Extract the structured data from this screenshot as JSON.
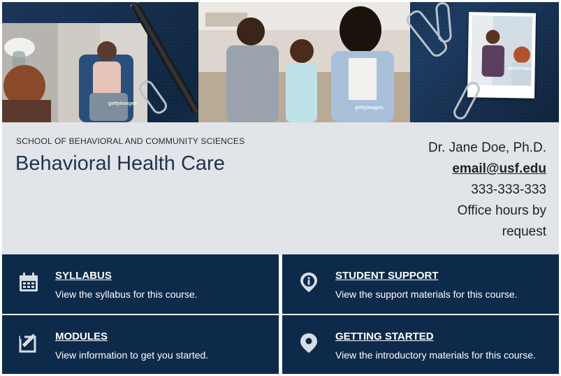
{
  "banner": {
    "watermark": "gettyimages"
  },
  "header": {
    "school": "SCHOOL OF BEHAVIORAL AND COMMUNITY SCIENCES",
    "title": "Behavioral Health Care"
  },
  "contact": {
    "name": "Dr. Jane Doe, Ph.D.",
    "email": "email@usf.edu",
    "phone": "333-333-333",
    "hours": "Office hours by request"
  },
  "tiles": [
    {
      "title": "SYLLABUS",
      "description": "View the syllabus for this course.",
      "icon": "calendar-icon"
    },
    {
      "title": "STUDENT SUPPORT",
      "description": "View the support materials for this course.",
      "icon": "info-icon"
    },
    {
      "title": "MODULES",
      "description": "View information to get you started.",
      "icon": "edit-icon"
    },
    {
      "title": "GETTING STARTED",
      "description": "View the introductory materials for this course.",
      "icon": "map-pin-icon"
    }
  ],
  "colors": {
    "tile_bg": "#0d2a4b",
    "header_bg": "#e1e4e8",
    "title_color": "#1f3350"
  }
}
